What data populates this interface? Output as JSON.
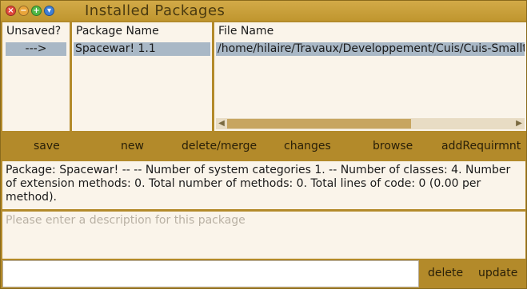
{
  "window": {
    "title": "Installed Packages",
    "controls": {
      "close": "×",
      "minimize": "−",
      "expand": "+",
      "menu": "▾"
    }
  },
  "columns": {
    "unsaved": {
      "header": "Unsaved?",
      "value": "--->"
    },
    "package_name": {
      "header": "Package Name",
      "value": "Spacewar! 1.1"
    },
    "file_name": {
      "header": "File Name",
      "value": "/home/hilaire/Travaux/Developpement/Cuis/Cuis-Smalltalk"
    }
  },
  "toolbar": {
    "save": "save",
    "new": "new",
    "delete_merge": "delete/merge",
    "changes": "changes",
    "browse": "browse",
    "add_requirement": "addRequirmnt"
  },
  "info": {
    "text": "Package: Spacewar! --  -- Number of system categories 1. -- Number of classes: 4. Number of extension methods: 0. Total number of methods: 0. Total lines of code: 0 (0.00 per method)."
  },
  "description": {
    "placeholder": "Please enter a description for this package"
  },
  "bottom": {
    "delete": "delete",
    "update": "update"
  },
  "colors": {
    "window_bg": "#b38a2a",
    "pane_bg": "#faf4ea",
    "selection": "#a9b8c6"
  }
}
